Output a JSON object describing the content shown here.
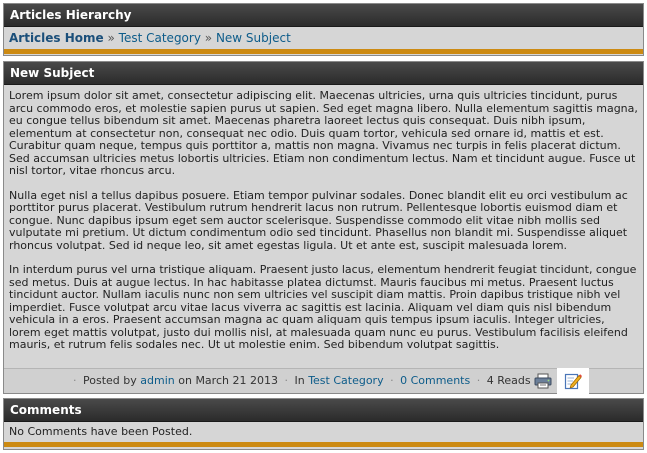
{
  "hierarchy": {
    "title": "Articles Hierarchy",
    "breadcrumb": {
      "home": "Articles Home",
      "sep1": "»",
      "category": "Test Category",
      "sep2": "»",
      "current": "New Subject"
    }
  },
  "article": {
    "title": "New Subject",
    "paragraphs": [
      "Lorem ipsum dolor sit amet, consectetur adipiscing elit. Maecenas ultricies, urna quis ultricies tincidunt, purus arcu commodo eros, et molestie sapien purus ut sapien. Sed eget magna libero. Nulla elementum sagittis magna, eu congue tellus bibendum sit amet. Maecenas pharetra laoreet lectus quis consequat. Duis nibh ipsum, elementum at consectetur non, consequat nec odio. Duis quam tortor, vehicula sed ornare id, mattis et est. Curabitur quam neque, tempus quis porttitor a, mattis non magna. Vivamus nec turpis in felis placerat dictum. Sed accumsan ultricies metus lobortis ultricies. Etiam non condimentum lectus. Nam et tincidunt augue. Fusce ut nisl tortor, vitae rhoncus arcu.",
      "Nulla eget nisl a tellus dapibus posuere. Etiam tempor pulvinar sodales. Donec blandit elit eu orci vestibulum ac porttitor purus placerat. Vestibulum rutrum hendrerit lacus non rutrum. Pellentesque lobortis euismod diam et congue. Nunc dapibus ipsum eget sem auctor scelerisque. Suspendisse commodo elit vitae nibh mollis sed vulputate mi pretium. Ut dictum condimentum odio sed tincidunt. Phasellus non blandit mi. Suspendisse aliquet rhoncus volutpat. Sed id neque leo, sit amet egestas ligula. Ut et ante est, suscipit malesuada lorem.",
      "In interdum purus vel urna tristique aliquam. Praesent justo lacus, elementum hendrerit feugiat tincidunt, congue sed metus. Duis at augue lectus. In hac habitasse platea dictumst. Mauris faucibus mi metus. Praesent luctus tincidunt auctor. Nullam iaculis nunc non sem ultricies vel suscipit diam mattis. Proin dapibus tristique nibh vel imperdiet. Fusce volutpat arcu vitae lacus viverra ac sagittis est lacinia. Aliquam vel diam quis nisl bibendum vehicula in a eros. Praesent accumsan magna ac quam aliquam quis tempus ipsum iaculis. Integer ultricies, lorem eget mattis volutpat, justo dui mollis nisl, at malesuada quam nunc eu purus. Vestibulum facilisis eleifend mauris, et rutrum felis sodales nec. Ut ut molestie enim. Sed bibendum volutpat sagittis."
    ],
    "meta": {
      "posted_by_label": "Posted by",
      "author": "admin",
      "on_label": "on",
      "date": "March 21 2013",
      "in_label": "In",
      "category": "Test Category",
      "comments_link": "0 Comments",
      "reads": "4 Reads",
      "separator": "·"
    },
    "icons": {
      "print": "printer-icon",
      "edit": "edit-icon"
    }
  },
  "comments": {
    "title": "Comments",
    "empty_text": "No Comments have been Posted."
  },
  "colors": {
    "header_bg": "#2b2b2b",
    "panel_bg": "#d6d6d6",
    "accent_bar": "#cc8a12",
    "link": "#0d5c8a"
  }
}
